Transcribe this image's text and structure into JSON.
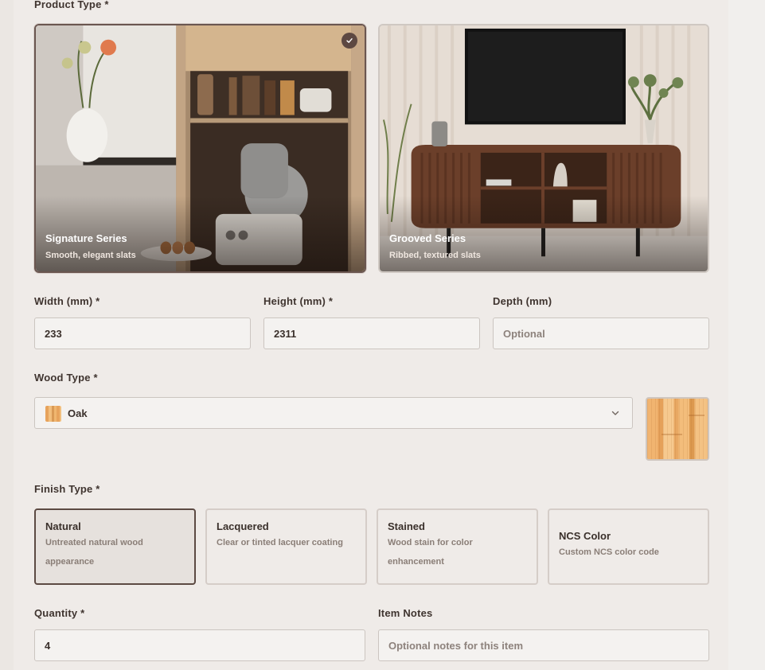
{
  "product_type": {
    "label": "Product Type",
    "required_mark": "*",
    "options": [
      {
        "title": "Signature Series",
        "subtitle": "Smooth, elegant slats",
        "selected": true
      },
      {
        "title": "Grooved Series",
        "subtitle": "Ribbed, textured slats",
        "selected": false
      }
    ]
  },
  "dimensions": {
    "width": {
      "label": "Width (mm) *",
      "value": "233"
    },
    "height": {
      "label": "Height (mm) *",
      "value": "2311"
    },
    "depth": {
      "label": "Depth (mm)",
      "value": "",
      "placeholder": "Optional"
    }
  },
  "wood_type": {
    "label": "Wood Type *",
    "selected": "Oak",
    "icon": "chevron-down-icon"
  },
  "finish_type": {
    "label": "Finish Type *",
    "options": [
      {
        "title": "Natural",
        "description": "Untreated natural wood appearance",
        "selected": true
      },
      {
        "title": "Lacquered",
        "description": "Clear or tinted lacquer coating",
        "selected": false
      },
      {
        "title": "Stained",
        "description": "Wood stain for color enhancement",
        "selected": false
      },
      {
        "title": "NCS Color",
        "description": "Custom NCS color code",
        "selected": false
      }
    ]
  },
  "quantity": {
    "label": "Quantity *",
    "value": "4"
  },
  "item_notes": {
    "label": "Item Notes",
    "value": "",
    "placeholder": "Optional notes for this item"
  },
  "colors": {
    "accent": "#5d4842",
    "panel": "#efebe8",
    "input_bg": "#f4f2f0",
    "border": "#cbc5c0"
  }
}
